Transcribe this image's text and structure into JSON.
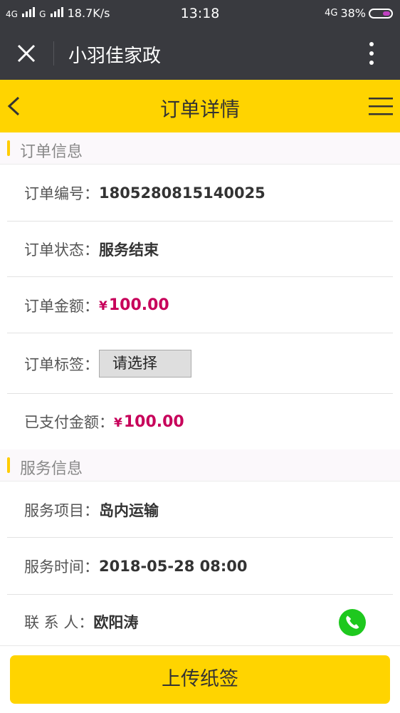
{
  "status_bar": {
    "network1": "4G",
    "network2": "G",
    "speed": "18.7K/s",
    "time": "13:18",
    "network3": "4G",
    "battery": "38%",
    "battery_level": 0.38
  },
  "wechat_bar": {
    "title": "小羽佳家政"
  },
  "header": {
    "title": "订单详情"
  },
  "order_section": {
    "title": "订单信息",
    "rows": {
      "number": {
        "label": "订单编号：",
        "value": "1805280815140025"
      },
      "status": {
        "label": "订单状态：",
        "value": "服务结束"
      },
      "amount": {
        "label": "订单金额：",
        "currency": "¥",
        "value": "100.00"
      },
      "tag": {
        "label": "订单标签：",
        "value": "请选择"
      },
      "paid": {
        "label": "已支付金额：",
        "currency": "¥",
        "value": "100.00"
      }
    }
  },
  "service_section": {
    "title": "服务信息",
    "rows": {
      "item": {
        "label": "服务项目：",
        "value": "岛内运输"
      },
      "time": {
        "label": "服务时间：",
        "value": "2018-05-28 08:00"
      },
      "contact": {
        "label": "联 系 人：",
        "value": "欧阳涛"
      }
    }
  },
  "footer": {
    "upload_label": "上传纸签"
  },
  "icons": {
    "close": "close-icon",
    "more": "more-vertical-icon",
    "back": "chevron-left-icon",
    "menu": "hamburger-menu-icon",
    "phone": "phone-icon"
  },
  "colors": {
    "header_yellow": "#ffd400",
    "price_magenta": "#c7005a",
    "section_accent": "#ffcc00",
    "phone_green": "#1ec81e",
    "wechat_bar": "#393a3f"
  }
}
